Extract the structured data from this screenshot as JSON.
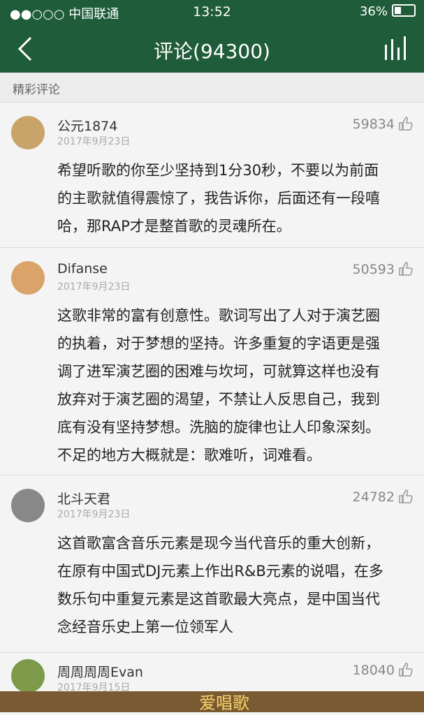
{
  "status": {
    "carrier": "●●○○○ 中国联通",
    "time": "13:52",
    "battery": "36%"
  },
  "nav": {
    "title": "评论(94300)"
  },
  "section_title": "精彩评论",
  "comments": [
    {
      "name": "公元1874",
      "date": "2017年9月23日",
      "likes": "59834",
      "lines": [
        "希望听歌的你至少坚持到1分30秒，不要以为前面",
        "的主歌就值得震惊了，我告诉你，后面还有一段嘻",
        "哈，那RAP才是整首歌的灵魂所在。"
      ]
    },
    {
      "name": "Difanse",
      "date": "2017年9月23日",
      "likes": "50593",
      "lines": [
        "这歌非常的富有创意性。歌词写出了人对于演艺圈",
        "的执着，对于梦想的坚持。许多重复的字语更是强",
        "调了进军演艺圈的困难与坎坷，可就算这样也没有",
        "放弃对于演艺圈的渴望，不禁让人反思自己，我到",
        "底有没有坚持梦想。洗脑的旋律也让人印象深刻。",
        "不足的地方大概就是：歌难听，词难看。"
      ]
    },
    {
      "name": "北斗天君",
      "date": "2017年9月23日",
      "likes": "24782",
      "lines": [
        "这首歌富含音乐元素是现今当代音乐的重大创新，",
        "在原有中国式DJ元素上作出R&B元素的说唱，在多",
        "数乐句中重复元素是这首歌最大亮点，是中国当代",
        "念经音乐史上第一位领军人"
      ]
    },
    {
      "name": "周周周周Evan",
      "date": "2017年9月15日",
      "likes": "18040",
      "lines": []
    }
  ],
  "watermark": "爱唱歌",
  "colors": {
    "header": "#1f5c3a",
    "background": "#f4f4f4"
  }
}
